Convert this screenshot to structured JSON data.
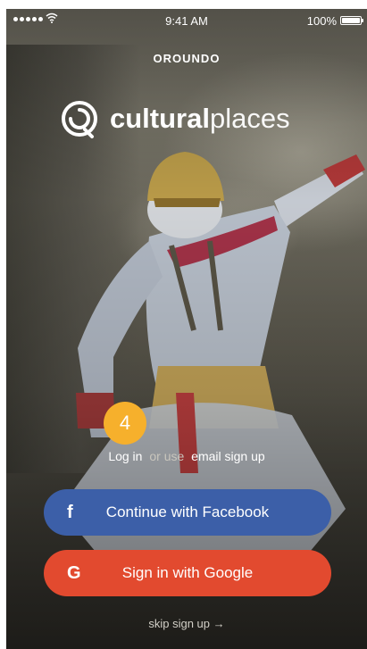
{
  "status_bar": {
    "time": "9:41 AM",
    "battery": "100%",
    "signal_icon": "signal-dots-icon",
    "wifi_icon": "wifi-icon",
    "battery_icon": "battery-icon"
  },
  "brand": {
    "publisher": "OROUNDO",
    "app_name_bold": "cultural",
    "app_name_light": "places",
    "logo_icon": "culturalplaces-logo-icon"
  },
  "step_badge": "4",
  "auth": {
    "login": "Log in",
    "or_use": "or use",
    "email_signup": "email sign up"
  },
  "buttons": {
    "facebook": {
      "icon": "f",
      "label": "Continue with Facebook"
    },
    "google": {
      "icon": "G",
      "label": "Sign in with Google"
    }
  },
  "skip": {
    "label": "skip sign up",
    "arrow": "→"
  },
  "colors": {
    "facebook": "#3c5fa8",
    "google": "#e24a2f",
    "badge": "#f6b02c"
  }
}
